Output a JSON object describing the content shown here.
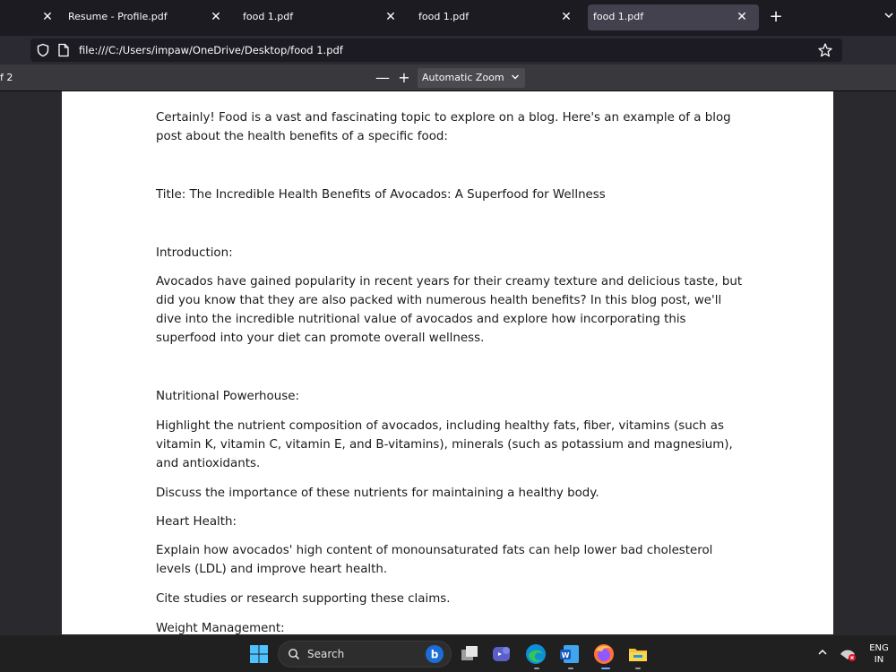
{
  "tabs": [
    {
      "label": "Resume - Profile.pdf",
      "active": false
    },
    {
      "label": "food 1.pdf",
      "active": false
    },
    {
      "label": "food 1.pdf",
      "active": false
    },
    {
      "label": "food 1.pdf",
      "active": true
    }
  ],
  "url": "file:///C:/Users/impaw/OneDrive/Desktop/food 1.pdf",
  "pdf_toolbar": {
    "page_count_fragment": "f 2",
    "zoom_minus": "—",
    "zoom_plus": "+",
    "zoom_value": "Automatic Zoom"
  },
  "document": {
    "paragraphs": [
      "Certainly! Food is a vast and fascinating topic to explore on a blog. Here's an example of a blog post about the health benefits of a specific food:",
      "Title: The Incredible Health Benefits of Avocados: A Superfood for Wellness",
      "Introduction:",
      "Avocados have gained popularity in recent years for their creamy texture and delicious taste, but did you know that they are also packed with numerous health benefits? In this blog post, we'll dive into the incredible nutritional value of avocados and explore how incorporating this superfood into your diet can promote overall wellness.",
      "Nutritional Powerhouse:",
      "Highlight the nutrient composition of avocados, including healthy fats, fiber, vitamins (such as vitamin K, vitamin C, vitamin E, and B-vitamins), minerals (such as potassium and magnesium), and antioxidants.",
      "Discuss the importance of these nutrients for maintaining a healthy body.",
      "Heart Health:",
      "Explain how avocados' high content of monounsaturated fats can help lower bad cholesterol levels (LDL) and improve heart health.",
      "Cite studies or research supporting these claims.",
      "Weight Management:"
    ]
  },
  "taskbar": {
    "search_label": "Search",
    "lang_line1": "ENG",
    "lang_line2": "IN"
  },
  "colors": {
    "accent_firefox": "#ff7139",
    "windows_blue": "#0078d4"
  }
}
